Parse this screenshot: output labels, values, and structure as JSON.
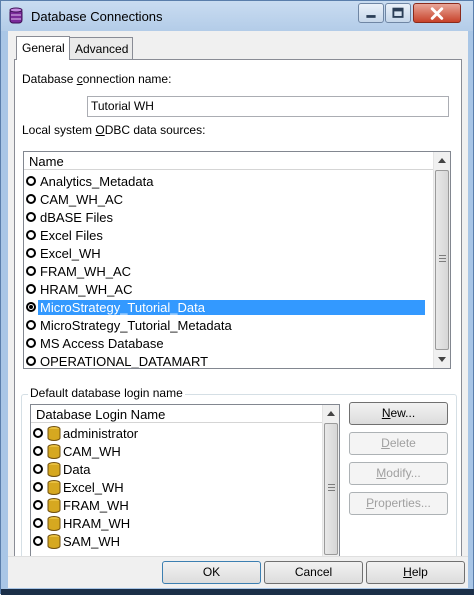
{
  "window": {
    "title": "Database Connections",
    "icon": "database-connections-icon"
  },
  "tabs": [
    {
      "label": "General",
      "selected": true
    },
    {
      "label": "Advanced",
      "selected": false
    }
  ],
  "general": {
    "connection_name_label_pre": "Database ",
    "connection_name_label_ul": "c",
    "connection_name_label_post": "onnection name:",
    "connection_name_value": "Tutorial WH",
    "odbc_label_pre": "Local system ",
    "odbc_label_ul": "O",
    "odbc_label_post": "DBC data sources:",
    "odbc_list": {
      "column_header": "Name",
      "items": [
        "Analytics_Metadata",
        "CAM_WH_AC",
        "dBASE Files",
        "Excel Files",
        "Excel_WH",
        "FRAM_WH_AC",
        "HRAM_WH_AC",
        "MicroStrategy_Tutorial_Data",
        "MicroStrategy_Tutorial_Metadata",
        "MS Access Database",
        "OPERATIONAL_DATAMART"
      ],
      "selected": "MicroStrategy_Tutorial_Data"
    },
    "login_group_label": "Default database login name",
    "login_list": {
      "column_header": "Database Login Name",
      "items": [
        "administrator",
        "CAM_WH",
        "Data",
        "Excel_WH",
        "FRAM_WH",
        "HRAM_WH",
        "SAM_WH"
      ]
    },
    "side_buttons": {
      "new_ul": "N",
      "new_rest": "ew...",
      "delete_ul": "D",
      "delete_rest": "elete",
      "modify_ul": "M",
      "modify_rest": "odify...",
      "properties_ul": "P",
      "properties_rest": "roperties..."
    }
  },
  "footer": {
    "ok_label": "OK",
    "cancel_label": "Cancel",
    "help_ul": "H",
    "help_rest": "elp"
  },
  "colors": {
    "selection": "#3399ff",
    "title_bar": "#b3cce8",
    "close_button": "#c7422a"
  }
}
